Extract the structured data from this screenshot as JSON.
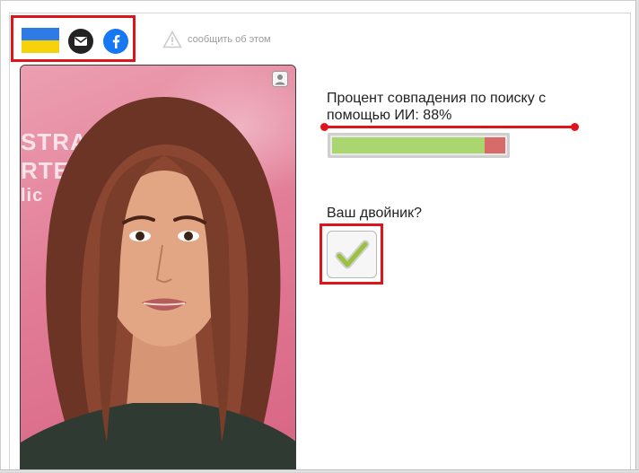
{
  "share": {
    "flag_icon": "ukraine-flag-icon",
    "mail_icon": "envelope-icon",
    "facebook_icon": "facebook-icon",
    "report_label": "сообщить об этом"
  },
  "photo": {
    "background_text_lines": [
      "STRA",
      "RTE",
      "lic"
    ],
    "person_icon": "person-icon"
  },
  "match": {
    "text": "Процент совпадения по поиску с помощью ИИ: 88%",
    "percent": 88
  },
  "twin": {
    "label": "Ваш двойник?",
    "check_icon": "checkmark-icon"
  },
  "colors": {
    "accent_red": "#e0141b",
    "bar_green": "#a9d66e",
    "bar_red": "#d96a6a",
    "facebook_blue": "#1877f2"
  }
}
